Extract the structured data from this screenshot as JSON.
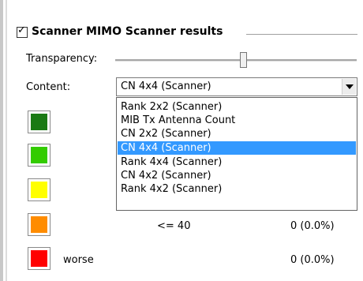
{
  "group": {
    "checked": true,
    "checkmark": "✓",
    "title": "Scanner MIMO Scanner results"
  },
  "transparency": {
    "label": "Transparency:",
    "level_fraction": 0.53
  },
  "content": {
    "label": "Content:",
    "selected": "CN 4x4 (Scanner)",
    "options": [
      "Rank 2x2 (Scanner)",
      "MIB Tx Antenna Count",
      "CN 2x2 (Scanner)",
      "CN 4x4 (Scanner)",
      "Rank 4x4 (Scanner)",
      "CN 4x2 (Scanner)",
      "Rank 4x2 (Scanner)"
    ],
    "highlighted_index": 3
  },
  "legend": [
    {
      "color": "#1a7a14",
      "label": "",
      "count": ""
    },
    {
      "color": "#33cc00",
      "label": "",
      "count": ""
    },
    {
      "color": "#ffff00",
      "label": "",
      "count": ""
    },
    {
      "color": "#ff8c00",
      "label": "<= 40",
      "count": "0 (0.0%)"
    },
    {
      "color": "#ff0000",
      "label": "worse",
      "count": "0 (0.0%)"
    }
  ]
}
